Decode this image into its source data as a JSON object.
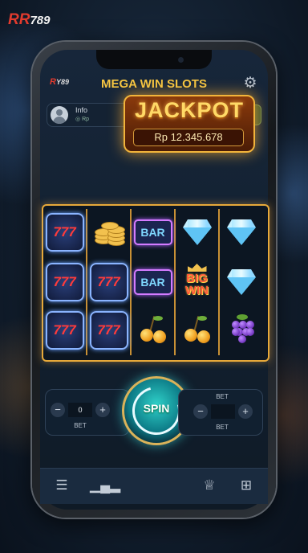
{
  "brand": {
    "prefix": "RR",
    "suffix": "789"
  },
  "header": {
    "logo_prefix": "R",
    "logo_suffix": "Y89",
    "title": "MEGA WIN SLOTS"
  },
  "user": {
    "name": "Info",
    "balance": "Rp",
    "currency_field": "Rp"
  },
  "jackpot": {
    "label": "JACKPOT",
    "amount": "Rp 12.345.678"
  },
  "reels": [
    [
      "777",
      "777",
      "777"
    ],
    [
      "coins",
      "777",
      "777"
    ],
    [
      "BAR",
      "BAR",
      "cherry"
    ],
    [
      "diamond",
      "BIG WIN",
      "cherry"
    ],
    [
      "diamond",
      "diamond",
      "grapes"
    ]
  ],
  "big_win": {
    "line1": "BIG",
    "line2": "WIN"
  },
  "bet_left": {
    "value": "0",
    "label": "BET"
  },
  "bet_right": {
    "top_label": "BET",
    "value": "",
    "label": "BET"
  },
  "spin": {
    "label": "SPIN"
  },
  "bottom_nav": [
    "menu-icon",
    "leaderboard-icon",
    "trophy-icon",
    "gift-icon"
  ],
  "colors": {
    "accent": "#f5c542",
    "spin": "#1aa7a8",
    "jackpot_border": "#f2b43b"
  }
}
